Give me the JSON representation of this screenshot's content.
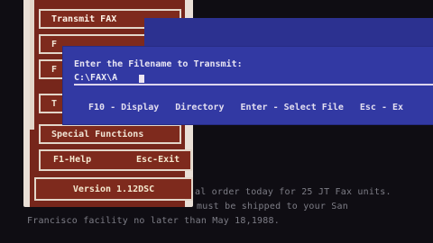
{
  "menu": {
    "items": [
      {
        "label": "Transmit FAX"
      },
      {
        "label": "F"
      },
      {
        "label": "F"
      },
      {
        "label": "T"
      },
      {
        "label": "Special Functions"
      }
    ],
    "help": {
      "f1": "F1-Help",
      "esc": "Esc-Exit"
    },
    "version": "Version 1.12DSC"
  },
  "dialog": {
    "prompt": "Enter the Filename to Transmit:",
    "input_value": "C:\\FAX\\A",
    "keys": [
      {
        "label": "F10 - Display"
      },
      {
        "label": "Directory"
      },
      {
        "label": "Enter - Select File"
      },
      {
        "label": "Esc - Ex"
      }
    ]
  },
  "background_text": {
    "line1": "al order today for 25 JT Fax units.",
    "line2": "must be shipped to your San",
    "line3": "Francisco facility no later than May 18,1988."
  },
  "colors": {
    "dialog_blue": "#3239a3",
    "menu_red": "#7e2a1d",
    "menu_border": "#e3d6c9"
  }
}
